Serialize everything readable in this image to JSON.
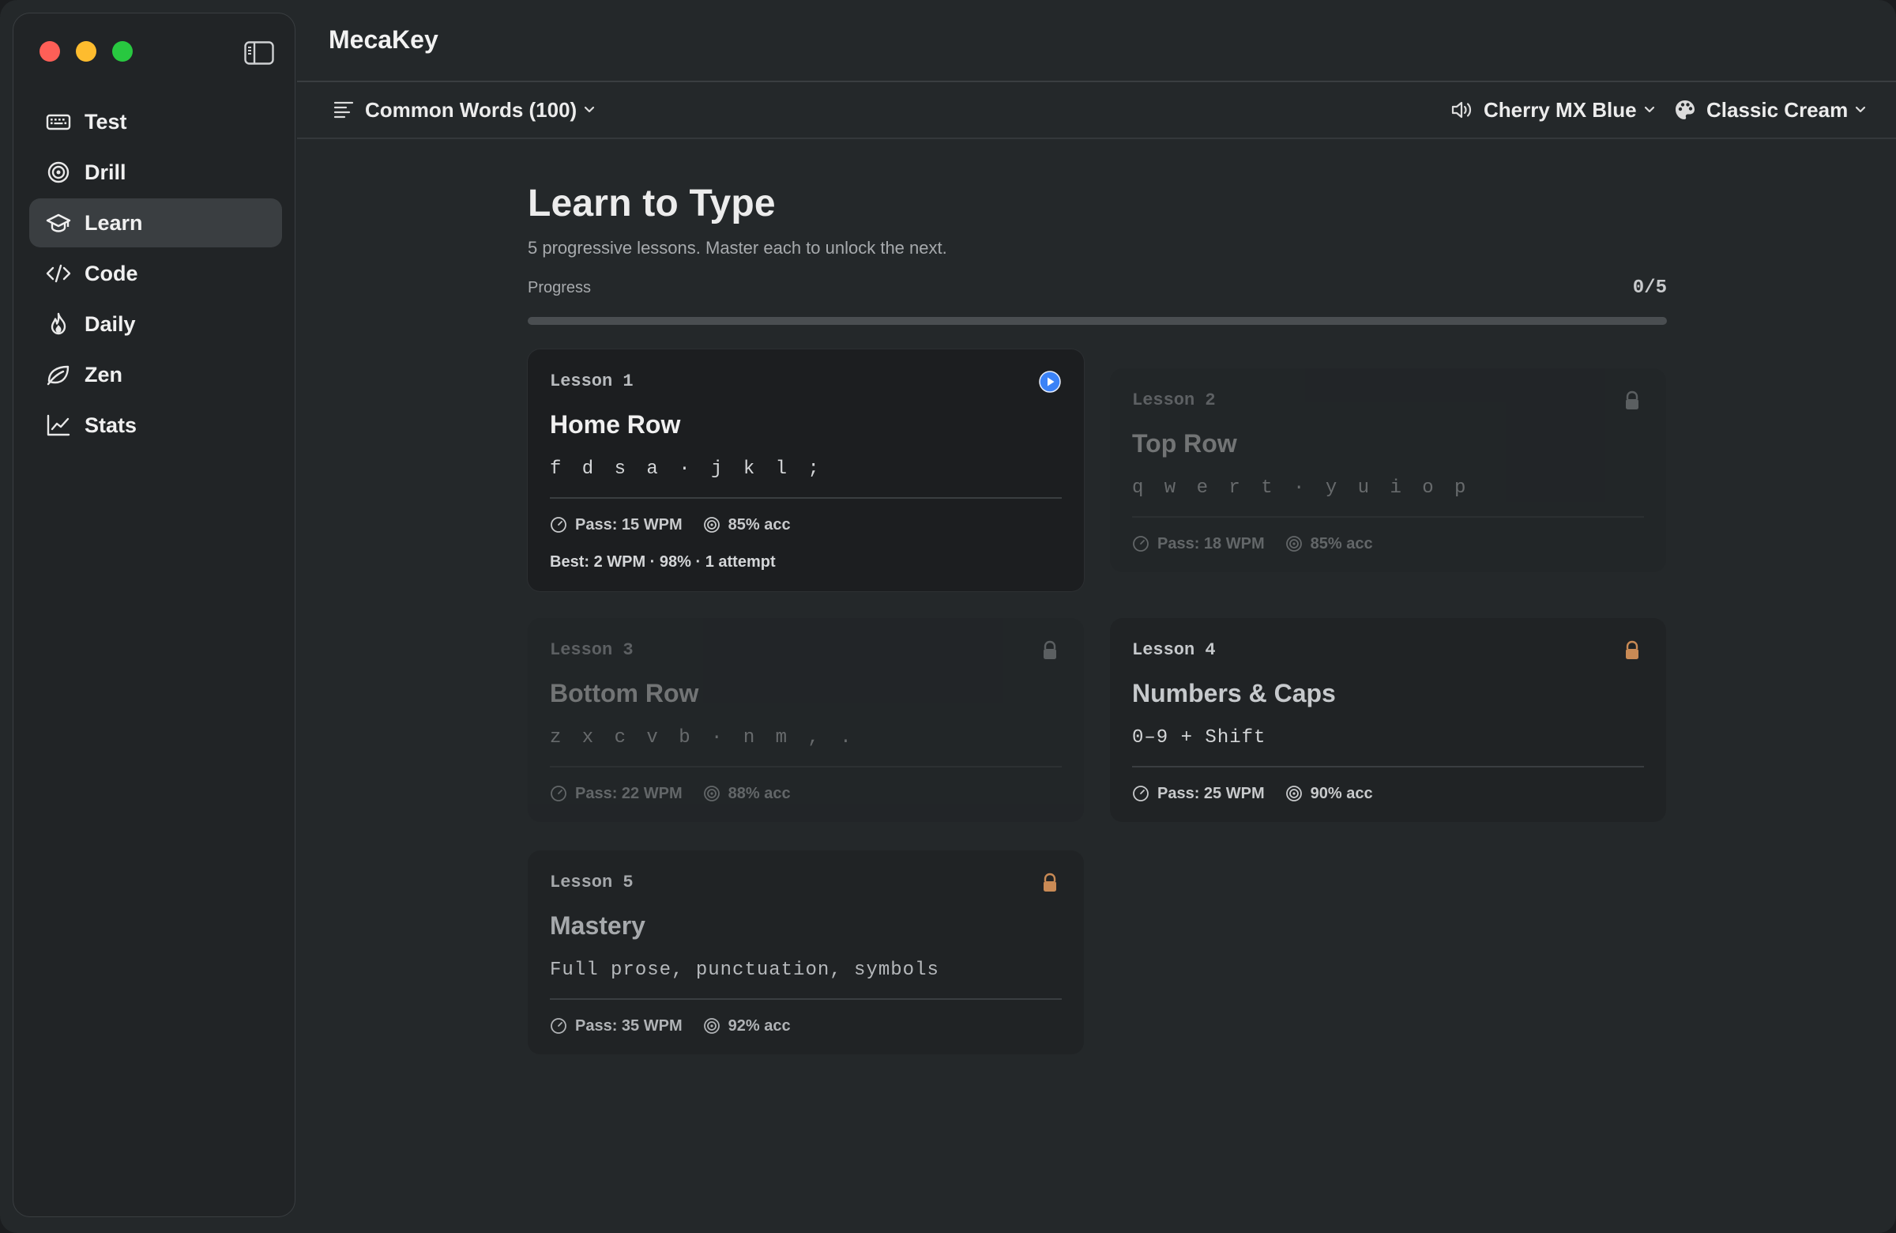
{
  "app": {
    "title": "MecaKey"
  },
  "sidebar": {
    "items": [
      {
        "label": "Test",
        "icon": "keyboard-icon",
        "active": false
      },
      {
        "label": "Drill",
        "icon": "target-icon",
        "active": false
      },
      {
        "label": "Learn",
        "icon": "graduation-cap-icon",
        "active": true
      },
      {
        "label": "Code",
        "icon": "code-icon",
        "active": false
      },
      {
        "label": "Daily",
        "icon": "flame-icon",
        "active": false
      },
      {
        "label": "Zen",
        "icon": "leaf-icon",
        "active": false
      },
      {
        "label": "Stats",
        "icon": "chart-line-icon",
        "active": false
      }
    ]
  },
  "toolbar": {
    "word_set": "Common Words (100)",
    "sound": "Cherry MX Blue",
    "theme": "Classic Cream"
  },
  "page": {
    "title": "Learn to Type",
    "subtitle": "5 progressive lessons. Master each to unlock the next.",
    "progress_label": "Progress",
    "progress_count": "0/5",
    "progress_fraction": 0
  },
  "lessons": [
    {
      "number": "Lesson 1",
      "name": "Home Row",
      "keys": "f d s a · j k l ;",
      "pass": "Pass: 15 WPM",
      "acc": "85% acc",
      "best": "Best: 2 WPM · 98% · 1 attempt",
      "status": "play-icon"
    },
    {
      "number": "Lesson 2",
      "name": "Top Row",
      "keys": "q w e r t · y u i o p",
      "pass": "Pass: 18 WPM",
      "acc": "85% acc",
      "status": "lock-icon"
    },
    {
      "number": "Lesson 3",
      "name": "Bottom Row",
      "keys": "z x c v b · n m , .",
      "pass": "Pass: 22 WPM",
      "acc": "88% acc",
      "status": "lock-icon"
    },
    {
      "number": "Lesson 4",
      "name": "Numbers & Caps",
      "keys": "0–9 + Shift",
      "pass": "Pass: 25 WPM",
      "acc": "90% acc",
      "status": "lock-icon"
    },
    {
      "number": "Lesson 5",
      "name": "Mastery",
      "keys": "Full prose, punctuation, symbols",
      "pass": "Pass: 35 WPM",
      "acc": "92% acc",
      "status": "lock-icon"
    }
  ],
  "colors": {
    "accent": "#3b82f6",
    "lock_orange": "#c98a55",
    "lock_gray": "#8a8e91"
  }
}
